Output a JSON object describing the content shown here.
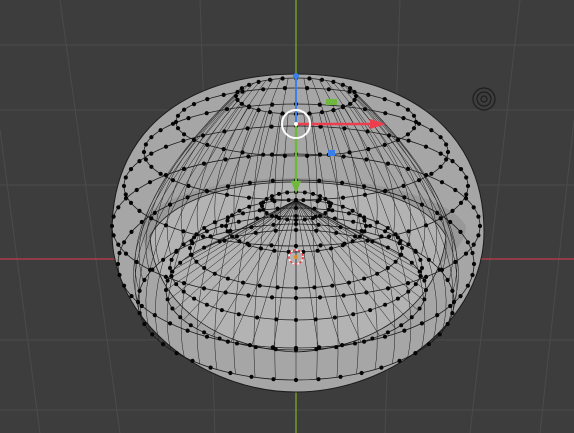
{
  "viewport": {
    "background": "#3d3d3d",
    "grid_color": "#4b4b4b",
    "axis_x_color": "#c43c48",
    "axis_y_color": "#6f9a2a"
  },
  "mesh": {
    "face_color": "#a6a6a6",
    "edge_color": "#1b1b1b",
    "vertex_color": "#050505"
  },
  "gizmo": {
    "x_arrow_color": "#ee3d4c",
    "y_handle_color": "#70b83c",
    "z_handle_color": "#3a7ee8",
    "center_ring_color": "#ffffff",
    "origin_color": "#e88a20"
  },
  "icons": {
    "camera_icon": "camera-icon",
    "cursor_3d_icon": "3d-cursor-icon",
    "origin_icon": "origin-dot-icon"
  }
}
